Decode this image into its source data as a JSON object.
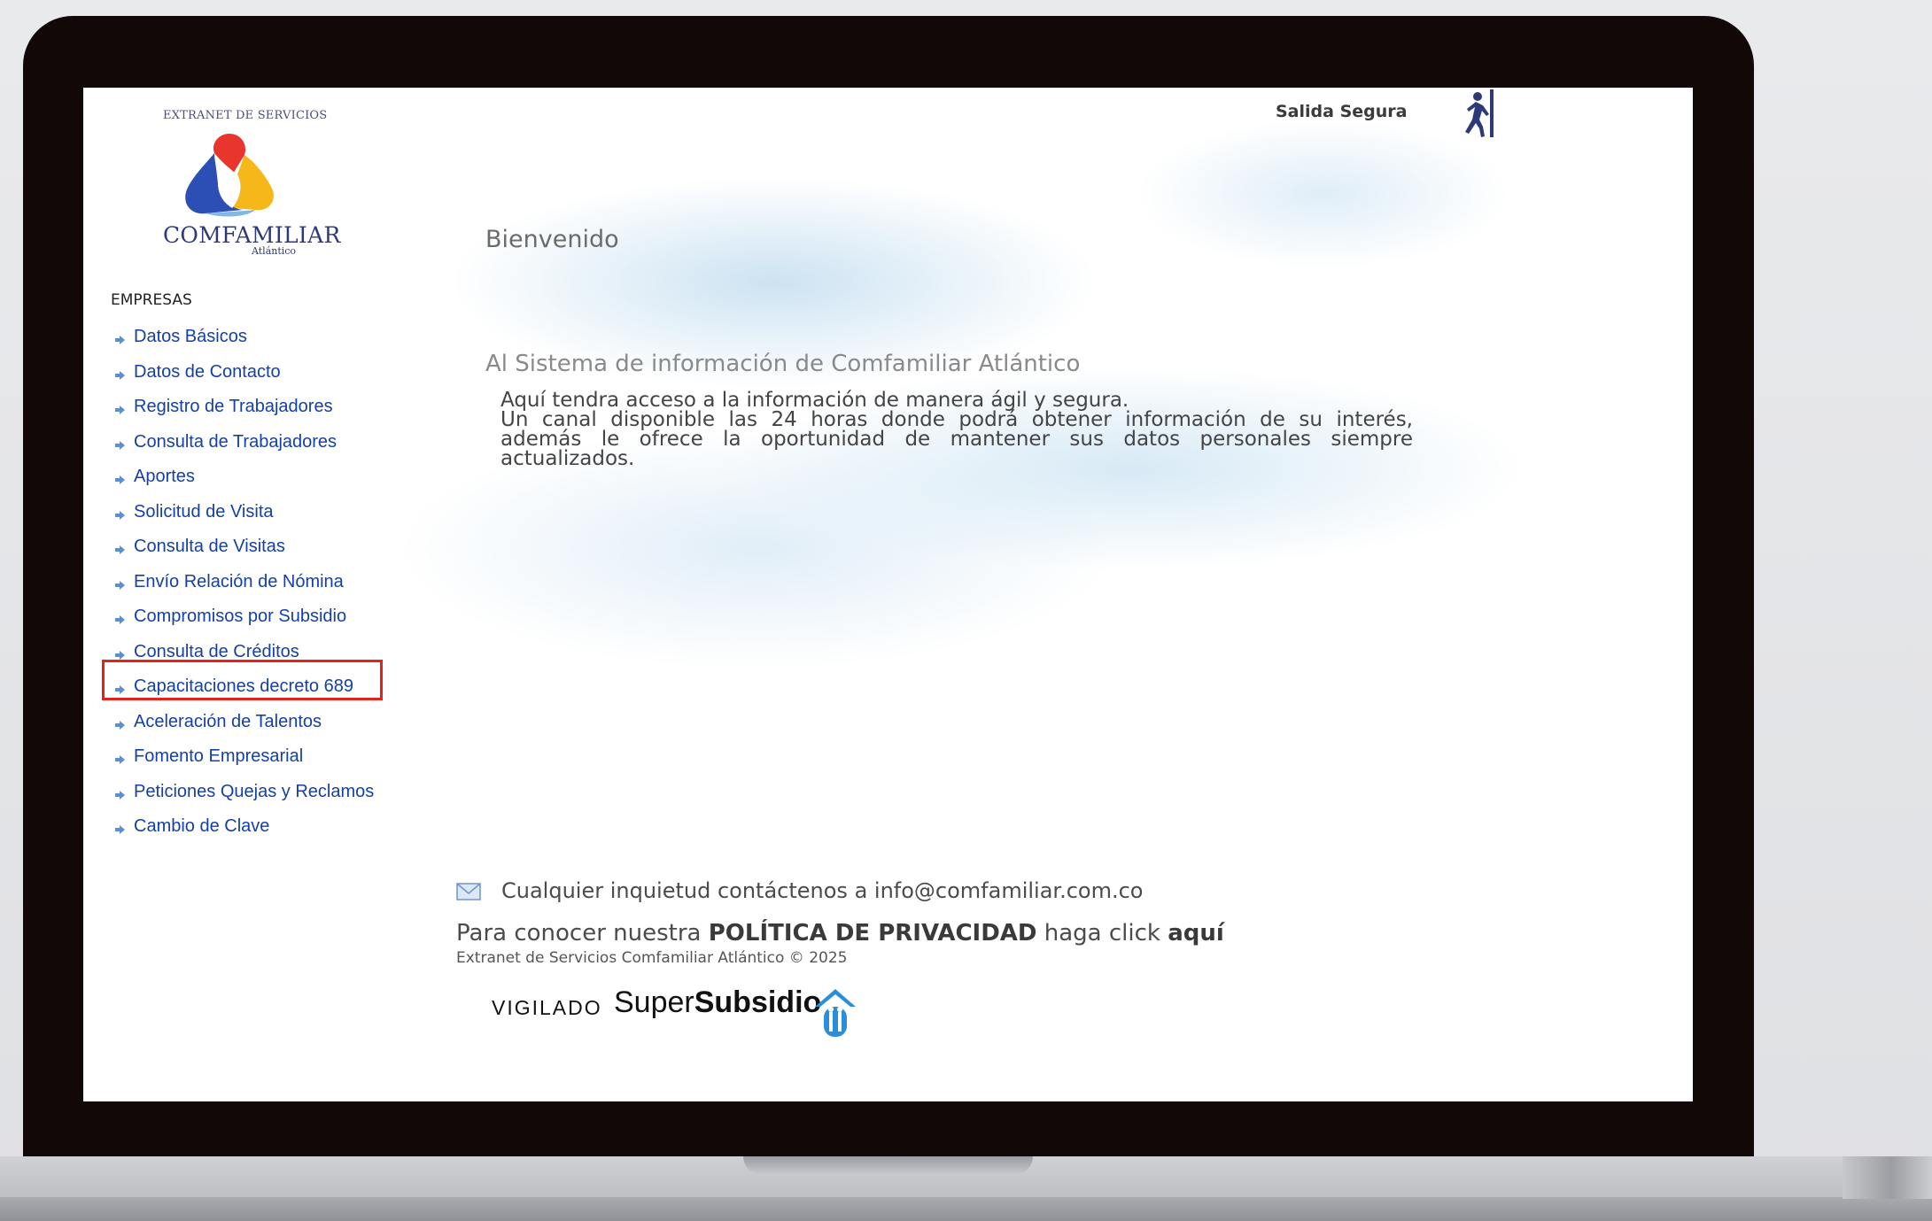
{
  "header": {
    "logout_label": "Salida Segura"
  },
  "logo": {
    "tagline": "EXTRANET DE SERVICIOS",
    "name": "COMFAMILIAR",
    "subname": "Atlántico"
  },
  "sidebar": {
    "section_title": "EMPRESAS",
    "items": [
      {
        "label": "Datos Básicos"
      },
      {
        "label": "Datos de Contacto"
      },
      {
        "label": "Registro de Trabajadores"
      },
      {
        "label": "Consulta de Trabajadores"
      },
      {
        "label": "Aportes"
      },
      {
        "label": "Solicitud de Visita"
      },
      {
        "label": "Consulta de Visitas"
      },
      {
        "label": "Envío Relación de Nómina"
      },
      {
        "label": "Compromisos por Subsidio"
      },
      {
        "label": "Consulta de Créditos"
      },
      {
        "label": "Capacitaciones decreto 689"
      },
      {
        "label": "Aceleración de Talentos"
      },
      {
        "label": "Fomento Empresarial"
      },
      {
        "label": "Peticiones Quejas y Reclamos"
      },
      {
        "label": "Cambio de Clave"
      }
    ],
    "highlighted_item": "Capacitaciones decreto 689"
  },
  "main": {
    "welcome": "Bienvenido",
    "subtitle": "Al Sistema de información de Comfamiliar Atlántico",
    "intro_line1": "Aquí tendra acceso a la información de manera ágil y segura.",
    "intro_line2": "Un canal disponible las 24 horas donde podrá obtener información de su interés, además le ofrece la oportunidad de mantener sus datos personales siempre actualizados."
  },
  "footer": {
    "contact": "Cualquier inquietud contáctenos a info@comfamiliar.com.co",
    "privacy_prefix": "Para conocer nuestra ",
    "privacy_strong": "POLÍTICA DE PRIVACIDAD",
    "privacy_middle": " haga click ",
    "privacy_link": "aquí",
    "copyright": "Extranet de Servicios Comfamiliar Atlántico © 2025",
    "vigilado": "VIGILADO",
    "brand_light": "Super",
    "brand_bold": "Subsidio"
  },
  "colors": {
    "link": "#1540a8",
    "highlight_border": "#e2231a",
    "bezel": "#120808"
  },
  "icons": {
    "bullet": "blue-arrow-bullet-icon",
    "logout": "exit-running-man-icon",
    "mail": "envelope-icon",
    "brand": "supersubsidio-house-icon"
  }
}
